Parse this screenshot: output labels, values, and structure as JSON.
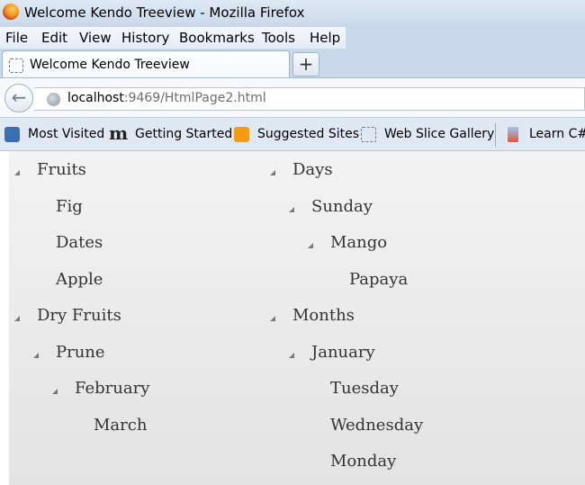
{
  "window": {
    "title": "Welcome Kendo Treeview - Mozilla Firefox"
  },
  "menu": [
    "File",
    "Edit",
    "View",
    "History",
    "Bookmarks",
    "Tools",
    "Help"
  ],
  "tab": {
    "label": "Welcome Kendo Treeview",
    "new_tab": "+"
  },
  "nav": {
    "back": "←",
    "url_host": "localhost",
    "url_rest": ":9469/HtmlPage2.html"
  },
  "bookmarks": [
    "Most Visited",
    "Getting Started",
    "Suggested Sites",
    "Web Slice Gallery",
    "Learn C#,"
  ],
  "tree_left": [
    {
      "label": "Fruits",
      "level": 0,
      "expanded": true
    },
    {
      "label": "Fig",
      "level": 1,
      "expanded": null
    },
    {
      "label": "Dates",
      "level": 1,
      "expanded": null
    },
    {
      "label": "Apple",
      "level": 1,
      "expanded": null
    },
    {
      "label": "Dry Fruits",
      "level": 0,
      "expanded": true
    },
    {
      "label": "Prune",
      "level": 1,
      "expanded": true
    },
    {
      "label": "February",
      "level": 2,
      "expanded": true
    },
    {
      "label": "March",
      "level": 3,
      "expanded": null
    }
  ],
  "tree_right": [
    {
      "label": "Days",
      "level": 0,
      "expanded": true
    },
    {
      "label": "Sunday",
      "level": 1,
      "expanded": true
    },
    {
      "label": "Mango",
      "level": 2,
      "expanded": true
    },
    {
      "label": "Papaya",
      "level": 3,
      "expanded": null
    },
    {
      "label": "Months",
      "level": 0,
      "expanded": true
    },
    {
      "label": "January",
      "level": 1,
      "expanded": true
    },
    {
      "label": "Tuesday",
      "level": 2,
      "expanded": null
    },
    {
      "label": "Wednesday",
      "level": 2,
      "expanded": null
    },
    {
      "label": "Monday",
      "level": 2,
      "expanded": null
    }
  ]
}
